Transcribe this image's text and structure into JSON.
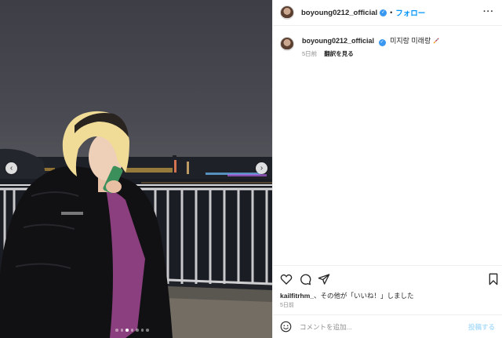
{
  "post": {
    "username": "boyoung0212_official",
    "follow_label": "フォロー",
    "more_label": "···",
    "dot": "•",
    "caption_text": "미지랑 미래랑",
    "caption_time": "5日前",
    "translate_label": "翻訳を見る",
    "likes_user": "kailfitrhm_",
    "likes_rest": "、その他が「いいね！」しました",
    "post_date": "5日前",
    "comment_placeholder": "コメントを追加...",
    "post_button": "投稿する"
  },
  "carousel": {
    "dot_count": 7,
    "active_index": 2,
    "prev_glyph": "‹",
    "next_glyph": "›"
  },
  "icons": [
    "verified-badge-icon",
    "more-options-icon",
    "heart-icon",
    "comment-icon",
    "share-icon",
    "bookmark-icon",
    "emoji-icon",
    "rocket-emoji-icon"
  ],
  "colors": {
    "link_blue": "#0095f6",
    "verified_blue": "#3897f0",
    "muted_gray": "#8e8e8e",
    "disabled_post": "#b2dffc"
  }
}
